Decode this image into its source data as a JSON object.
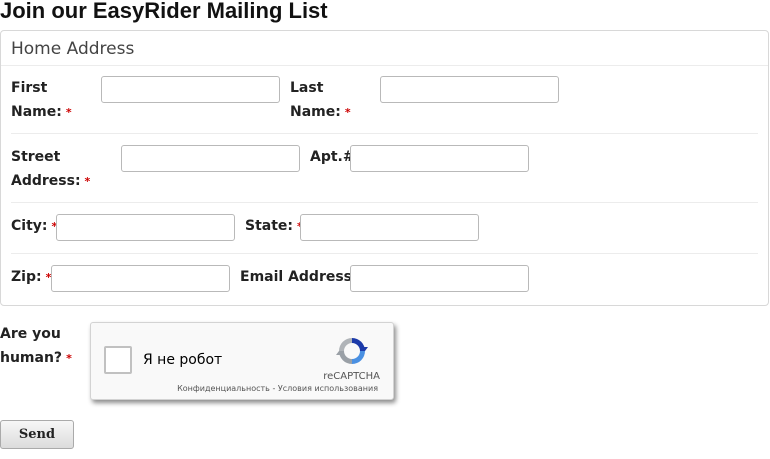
{
  "title": "Join our EasyRider Mailing List",
  "section": {
    "legend": "Home Address"
  },
  "required_marker": "*",
  "fields": {
    "first_name": {
      "label_line1": "First",
      "label_line2": "Name:",
      "value": ""
    },
    "last_name": {
      "label_line1": "Last",
      "label_line2": "Name:",
      "value": ""
    },
    "street": {
      "label_line1": "Street",
      "label_line2": "Address:",
      "value": ""
    },
    "apt": {
      "label": "Apt.#:",
      "value": ""
    },
    "city": {
      "label": "City:",
      "value": ""
    },
    "state": {
      "label": "State:",
      "value": ""
    },
    "zip": {
      "label": "Zip:",
      "value": ""
    },
    "email": {
      "label": "Email Address",
      "value": ""
    }
  },
  "human": {
    "label_line1": "Are you",
    "label_line2": "human?"
  },
  "captcha": {
    "label": "Я не робот",
    "brand": "reCAPTCHA",
    "privacy": "Конфиденциальность",
    "separator": " - ",
    "terms": "Условия использования"
  },
  "send_label": "Send"
}
